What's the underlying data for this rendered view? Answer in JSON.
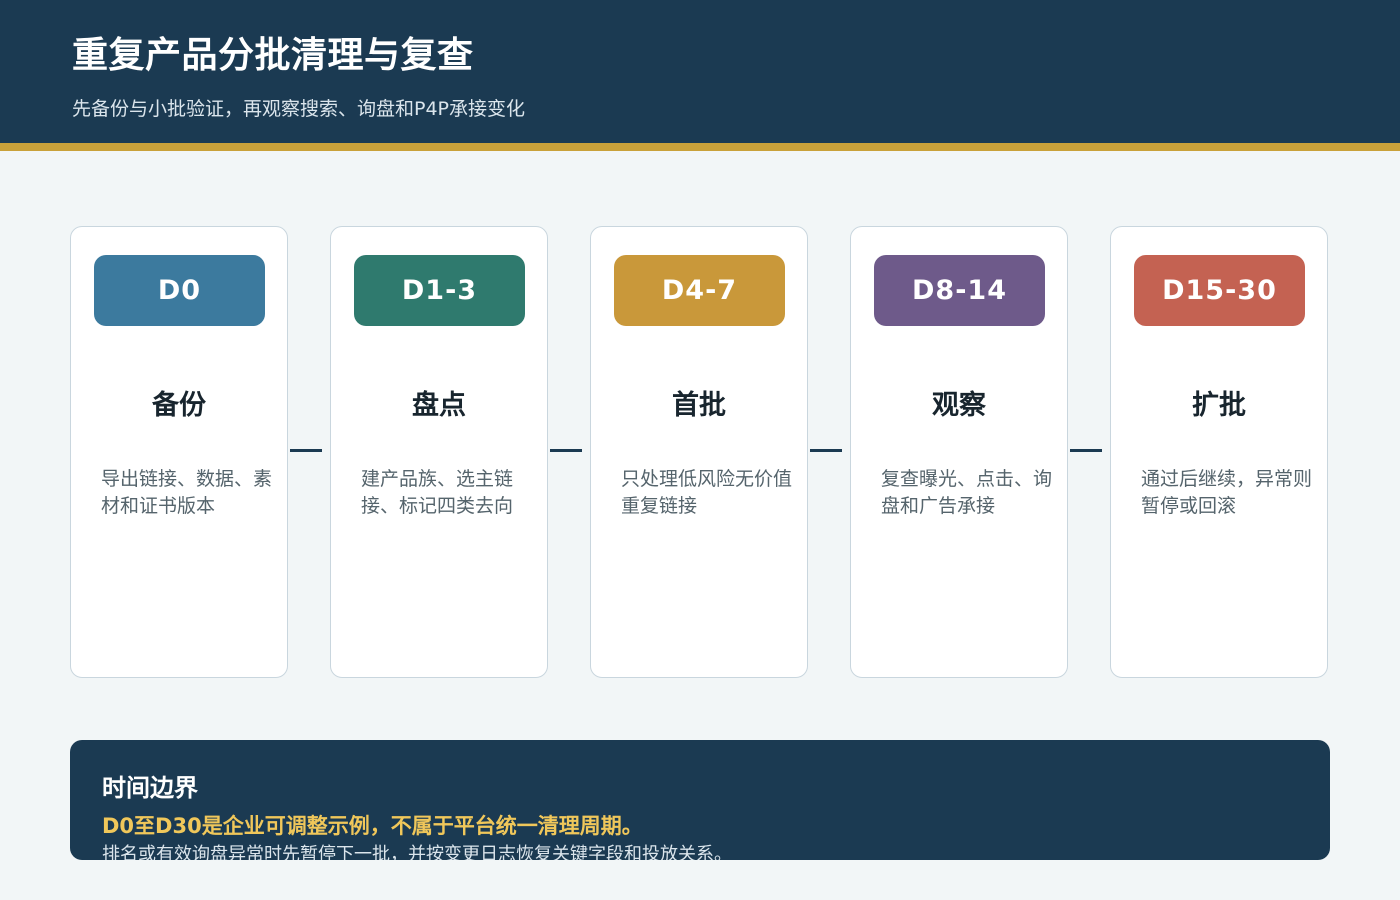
{
  "header": {
    "title": "重复产品分批清理与复查",
    "subtitle": "先备份与小批验证，再观察搜索、询盘和P4P承接变化"
  },
  "steps": [
    {
      "stage": "D0",
      "title": "备份",
      "desc": "导出链接、数据、素材和证书版本",
      "color": "#3c7a9e"
    },
    {
      "stage": "D1-3",
      "title": "盘点",
      "desc": "建产品族、选主链接、标记四类去向",
      "color": "#2f7a6e"
    },
    {
      "stage": "D4-7",
      "title": "首批",
      "desc": "只处理低风险无价值重复链接",
      "color": "#c9983a"
    },
    {
      "stage": "D8-14",
      "title": "观察",
      "desc": "复查曝光、点击、询盘和广告承接",
      "color": "#6e5a8a"
    },
    {
      "stage": "D15-30",
      "title": "扩批",
      "desc": "通过后继续，异常则暂停或回滚",
      "color": "#c46252"
    }
  ],
  "footer": {
    "heading": "时间边界",
    "highlight": "D0至D30是企业可调整示例，不属于平台统一清理周期。",
    "note": "排名或有效询盘异常时先暂停下一批，并按变更日志恢复关键字段和投放关系。"
  },
  "colors": {
    "header_bg": "#1b3a52",
    "accent": "#c9a13a",
    "highlight_text": "#f0c75a"
  }
}
